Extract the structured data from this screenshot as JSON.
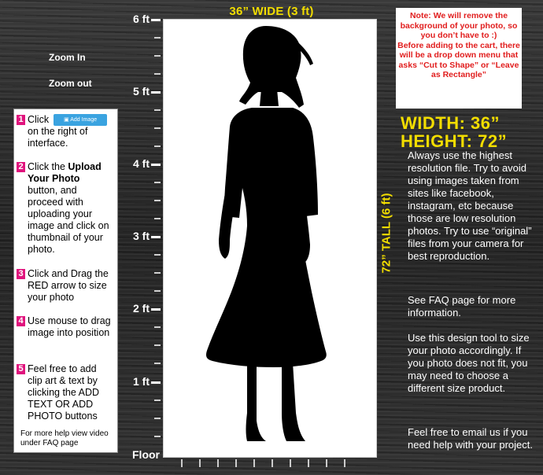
{
  "ruler": {
    "labels": [
      "6 ft",
      "5 ft",
      "4 ft",
      "3 ft",
      "2 ft",
      "1 ft"
    ],
    "floor": "Floor"
  },
  "canvas": {
    "wide_label": "36” WIDE (3 ft)",
    "tall_label": "72” TALL (6 ft)"
  },
  "zoom": {
    "in": "Zoom In",
    "out": "Zoom out"
  },
  "instructions": {
    "step1": {
      "num": "1",
      "text_before": "Click",
      "button": "Add Image",
      "text_after": "on the right of interface."
    },
    "step2": {
      "num": "2",
      "text_before": "Click the ",
      "bold": "Upload Your Photo",
      "text_after": " button, and proceed with uploading your image and click on thumbnail of your photo."
    },
    "step3": {
      "num": "3",
      "text": "Click and Drag the RED arrow to size your photo"
    },
    "step4": {
      "num": "4",
      "text": "Use mouse to drag image into position"
    },
    "step5": {
      "num": "5",
      "text": "Feel free to add clip art & text by clicking the ADD TEXT OR ADD PHOTO buttons"
    },
    "help": "For more help view video under FAQ page"
  },
  "note": {
    "bold": "Note: We will remove the background of your photo, so you don’t have to :)",
    "text": "Before adding to the cart, there will be a drop down menu that asks “Cut to Shape” or “Leave as Rectangle”"
  },
  "dimensions": {
    "width": "WIDTH: 36”",
    "height": "HEIGHT: 72”"
  },
  "info": {
    "p1": "Always use the highest resolution file. Try to avoid using images taken from sites like facebook, instagram, etc because those are low resolution photos. Try to use “original” files from your camera for best reproduction.",
    "p2": "See FAQ page for more information.",
    "p3": "Use this design tool to size your photo accordingly.  If you photo does not fit, you may need to choose a different size product.",
    "p4": "Feel free to email us if you need help with your project."
  },
  "colors": {
    "accent_yellow": "#f2dd00",
    "step_pink": "#e0147d",
    "note_red": "#e11d1d",
    "button_blue": "#3aa3e0"
  },
  "icons": {
    "silhouette": "girl-silhouette"
  }
}
